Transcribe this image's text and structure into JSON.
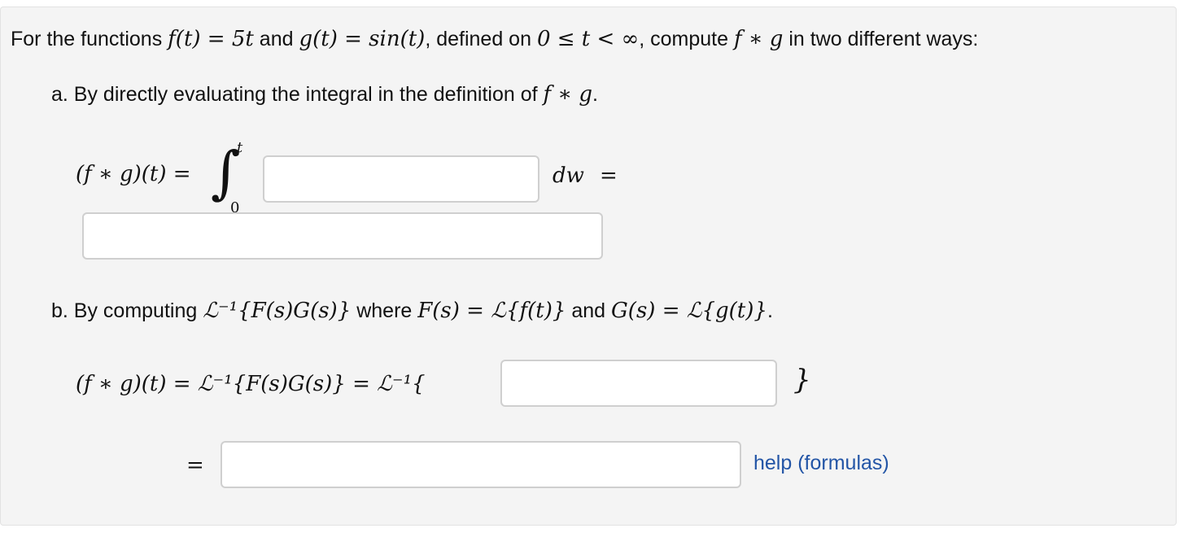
{
  "problem": {
    "intro_prefix": "For the functions",
    "f_def": "f(t) = 5t",
    "and_1": "and",
    "g_def": "g(t) = sin(t)",
    "defined_on": ", defined on",
    "domain": "0 ≤ t < ∞",
    "compute": ", compute",
    "conv": "f ∗ g",
    "intro_suffix": "in two different ways:"
  },
  "part_a": {
    "label": "a. By directly evaluating the integral in the definition of",
    "conv": "f ∗ g",
    "period": ".",
    "lhs": "(f ∗ g)(t) =",
    "upper_limit": "t",
    "lower_limit": "0",
    "dw": "dw",
    "equals": "=",
    "integrand_value": "",
    "result_value": ""
  },
  "part_b": {
    "label_prefix": "b. By computing",
    "inverse_expr": "ℒ⁻¹{F(s)G(s)}",
    "where": "where",
    "F_def": "F(s) = ℒ{f(t)}",
    "and": "and",
    "G_def": "G(s) = ℒ{g(t)}",
    "period": ".",
    "lhs": "(f ∗ g)(t) = ℒ⁻¹{F(s)G(s)} = ℒ⁻¹{",
    "close_brace": "}",
    "transform_value": "",
    "equals": "=",
    "result_value": ""
  },
  "help_link": "help (formulas)"
}
